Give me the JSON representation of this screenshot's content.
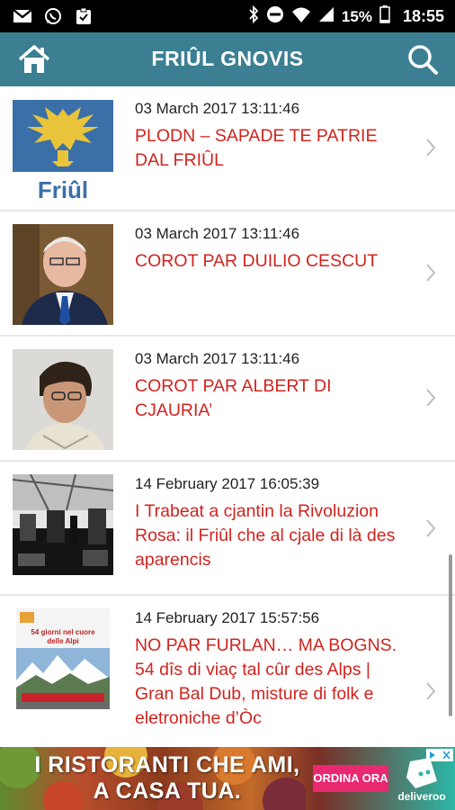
{
  "status_bar": {
    "battery": "15%",
    "time": "18:55",
    "left_icons": [
      "gmail-icon",
      "whatsapp-icon",
      "clipboard-icon"
    ],
    "right_icons": [
      "bluetooth-icon",
      "do-not-disturb-icon",
      "wifi-icon",
      "signal-icon",
      "battery-icon"
    ]
  },
  "app_bar": {
    "title": "FRIÛL GNOVIS",
    "background": "#3c7f93"
  },
  "articles": [
    {
      "date": "03 March 2017 13:11:46",
      "title": "PLODN – SAPADE TE PATRIE DAL FRIÛL",
      "thumb_caption": "Friûl",
      "thumb": "friul-eagle-flag"
    },
    {
      "date": "03 March 2017 13:11:46",
      "title": "COROT PAR DUILIO CESCUT",
      "thumb": "portrait-elderly-man"
    },
    {
      "date": "03 March 2017 13:11:46",
      "title": "COROT PAR ALBERT DI CJAURIA’",
      "thumb": "portrait-man-glasses"
    },
    {
      "date": "14 February 2017 16:05:39",
      "title": "I Trabeat a cjantin la Rivoluzion Rosa: il Friûl che al cjale di là des aparencis",
      "thumb": "band-on-stage-bw"
    },
    {
      "date": "14 February 2017 15:57:56",
      "title": "NO PAR FURLAN… MA BOGNS. 54 dîs di viaç tal cûr des Alps | Gran Bal Dub, misture di folk e eletroniche d’Òc",
      "thumb": "book-cover-alps",
      "thumb_lines": [
        "54 giorni nel cuore",
        "delle Alpi"
      ]
    }
  ],
  "ad": {
    "headline_line1": "I RISTORANTI CHE AMI,",
    "headline_line2": "A CASA TUA.",
    "button": "ORDINA ORA",
    "brand": "deliveroo",
    "brand_color": "#2bb7a6",
    "button_color": "#e8286f"
  },
  "colors": {
    "title_red": "#d0241f",
    "date_text": "#222222"
  }
}
